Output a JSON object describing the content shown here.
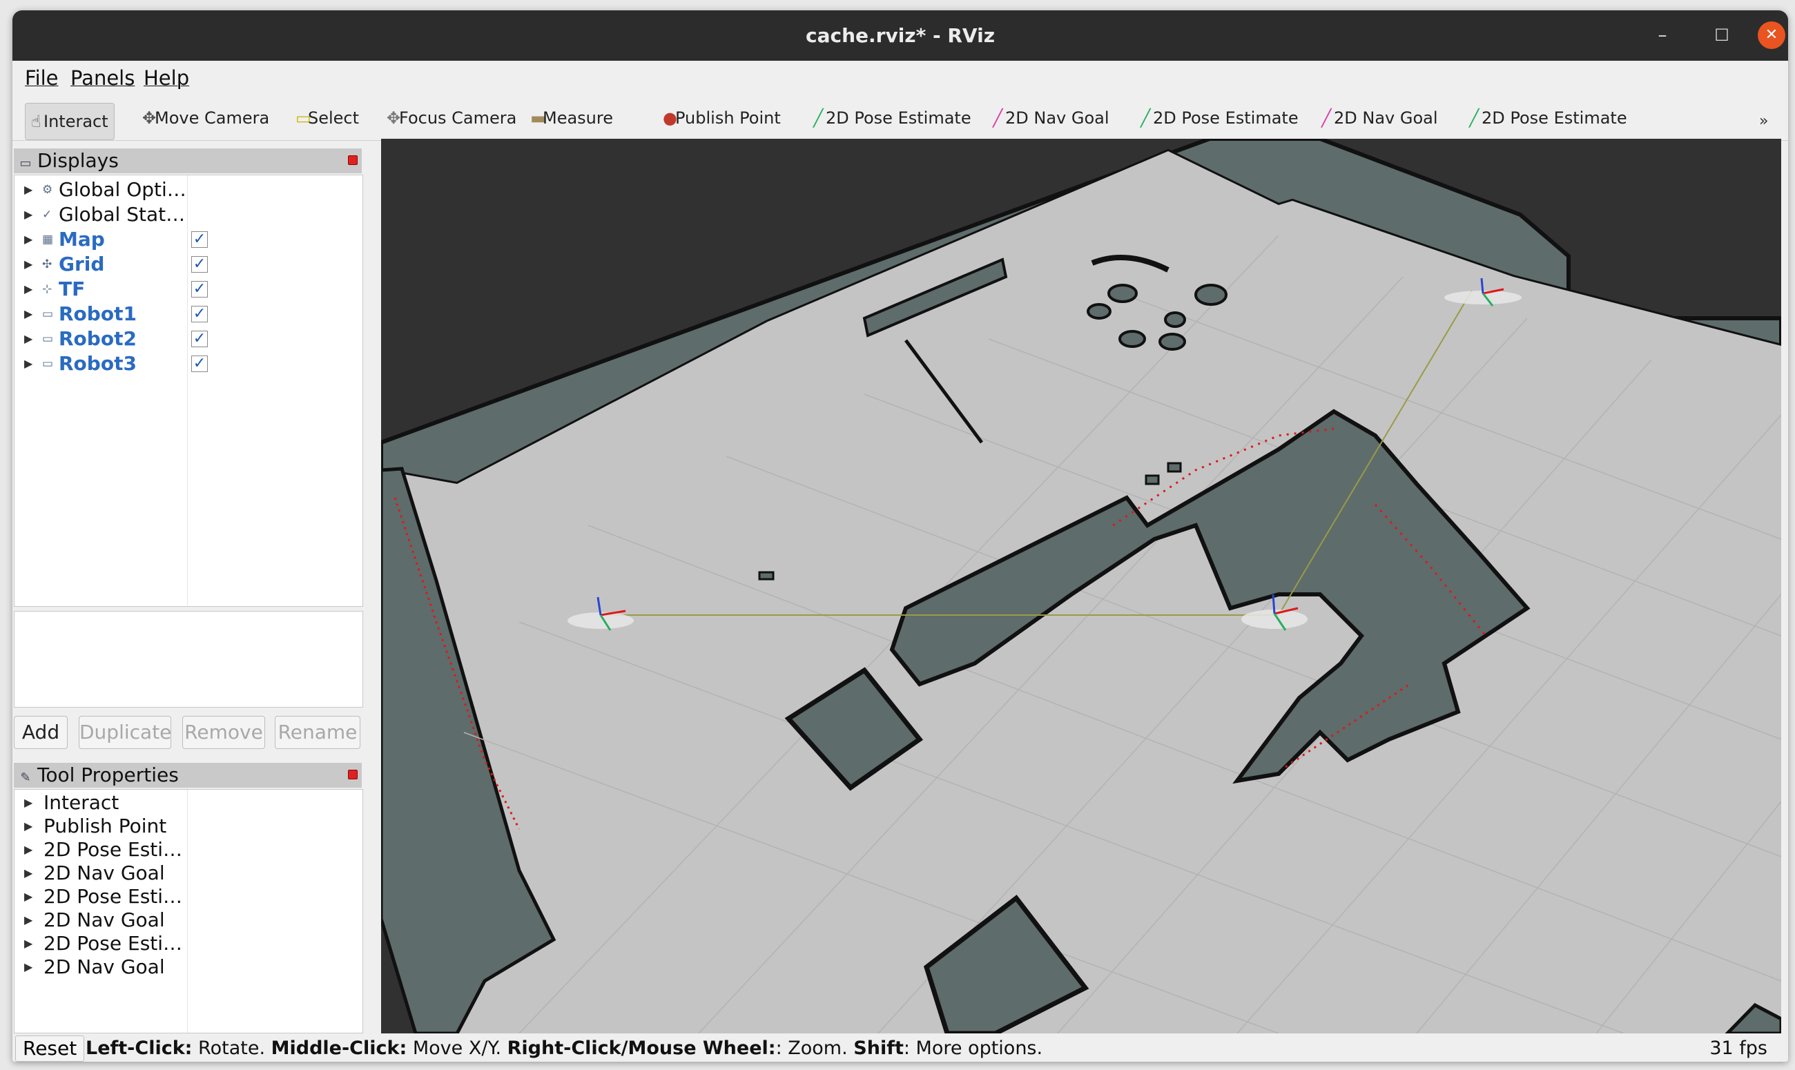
{
  "window": {
    "title": "cache.rviz* - RViz",
    "controls": {
      "minimize": "–",
      "maximize": "☐",
      "close": "✕"
    }
  },
  "menu": [
    "File",
    "Panels",
    "Help"
  ],
  "toolbar": {
    "tools": [
      {
        "label": "Interact",
        "icon": "hand-icon",
        "glyph": "☝",
        "color": "#555555",
        "active": true
      },
      {
        "label": "Move Camera",
        "icon": "move-camera-icon",
        "glyph": "✥",
        "color": "#555555"
      },
      {
        "label": "Select",
        "icon": "select-icon",
        "glyph": "▭",
        "color": "#c8b400"
      },
      {
        "label": "Focus Camera",
        "icon": "focus-camera-icon",
        "glyph": "✥",
        "color": "#777777"
      },
      {
        "label": "Measure",
        "icon": "ruler-icon",
        "glyph": "▬",
        "color": "#a08c5a"
      },
      {
        "label": "Publish Point",
        "icon": "map-pin-icon",
        "glyph": "●",
        "color": "#c0392b"
      },
      {
        "label": "2D Pose Estimate",
        "icon": "pose-arrow-icon",
        "glyph": "╱",
        "color": "#27ae60"
      },
      {
        "label": "2D Nav Goal",
        "icon": "goal-arrow-icon",
        "glyph": "╱",
        "color": "#d63da8"
      },
      {
        "label": "2D Pose Estimate",
        "icon": "pose-arrow-icon",
        "glyph": "╱",
        "color": "#27ae60"
      },
      {
        "label": "2D Nav Goal",
        "icon": "goal-arrow-icon",
        "glyph": "╱",
        "color": "#d63da8"
      },
      {
        "label": "2D Pose Estimate",
        "icon": "pose-arrow-icon",
        "glyph": "╱",
        "color": "#27ae60"
      }
    ],
    "overflow": "»"
  },
  "displays_panel": {
    "title": "Displays",
    "items": [
      {
        "label": "Global Opti…",
        "icon": "gear-icon",
        "glyph": "⚙",
        "checkable": false,
        "link": false
      },
      {
        "label": "Global Stat…",
        "icon": "checkmark-icon",
        "glyph": "✓",
        "checkable": false,
        "link": false
      },
      {
        "label": "Map",
        "icon": "map-icon",
        "glyph": "▦",
        "checkable": true,
        "checked": true,
        "link": true
      },
      {
        "label": "Grid",
        "icon": "grid-icon",
        "glyph": "✣",
        "checkable": true,
        "checked": true,
        "link": true
      },
      {
        "label": "TF",
        "icon": "tf-axes-icon",
        "glyph": "⊹",
        "checkable": true,
        "checked": true,
        "link": true
      },
      {
        "label": "Robot1",
        "icon": "folder-icon",
        "glyph": "▭",
        "checkable": true,
        "checked": true,
        "link": true
      },
      {
        "label": "Robot2",
        "icon": "folder-icon",
        "glyph": "▭",
        "checkable": true,
        "checked": true,
        "link": true
      },
      {
        "label": "Robot3",
        "icon": "folder-icon",
        "glyph": "▭",
        "checkable": true,
        "checked": true,
        "link": true
      }
    ],
    "buttons": {
      "add": "Add",
      "duplicate": "Duplicate",
      "remove": "Remove",
      "rename": "Rename"
    }
  },
  "tool_properties": {
    "title": "Tool Properties",
    "items": [
      "Interact",
      "Publish Point",
      "2D Pose Esti…",
      "2D Nav Goal",
      "2D Pose Esti…",
      "2D Nav Goal",
      "2D Pose Esti…",
      "2D Nav Goal"
    ]
  },
  "status": {
    "reset": "Reset",
    "hint_parts": [
      {
        "text": "Left-Click:",
        "bold": true
      },
      {
        "text": " Rotate. ",
        "bold": false
      },
      {
        "text": "Middle-Click:",
        "bold": true
      },
      {
        "text": " Move X/Y. ",
        "bold": false
      },
      {
        "text": "Right-Click/Mouse Wheel:",
        "bold": true
      },
      {
        "text": ": Zoom. ",
        "bold": false
      },
      {
        "text": "Shift",
        "bold": true
      },
      {
        "text": ": More options.",
        "bold": false
      }
    ],
    "fps": "31 fps"
  },
  "colors": {
    "background": "#313131",
    "free_space": "#c4c4c4",
    "obstacle_fill": "#5e6c6b",
    "wall_edge": "#111111",
    "laser": "#e01818",
    "tf_link": "#9a9a48",
    "close_button": "#e95420",
    "link_text": "#2a6bc1"
  }
}
